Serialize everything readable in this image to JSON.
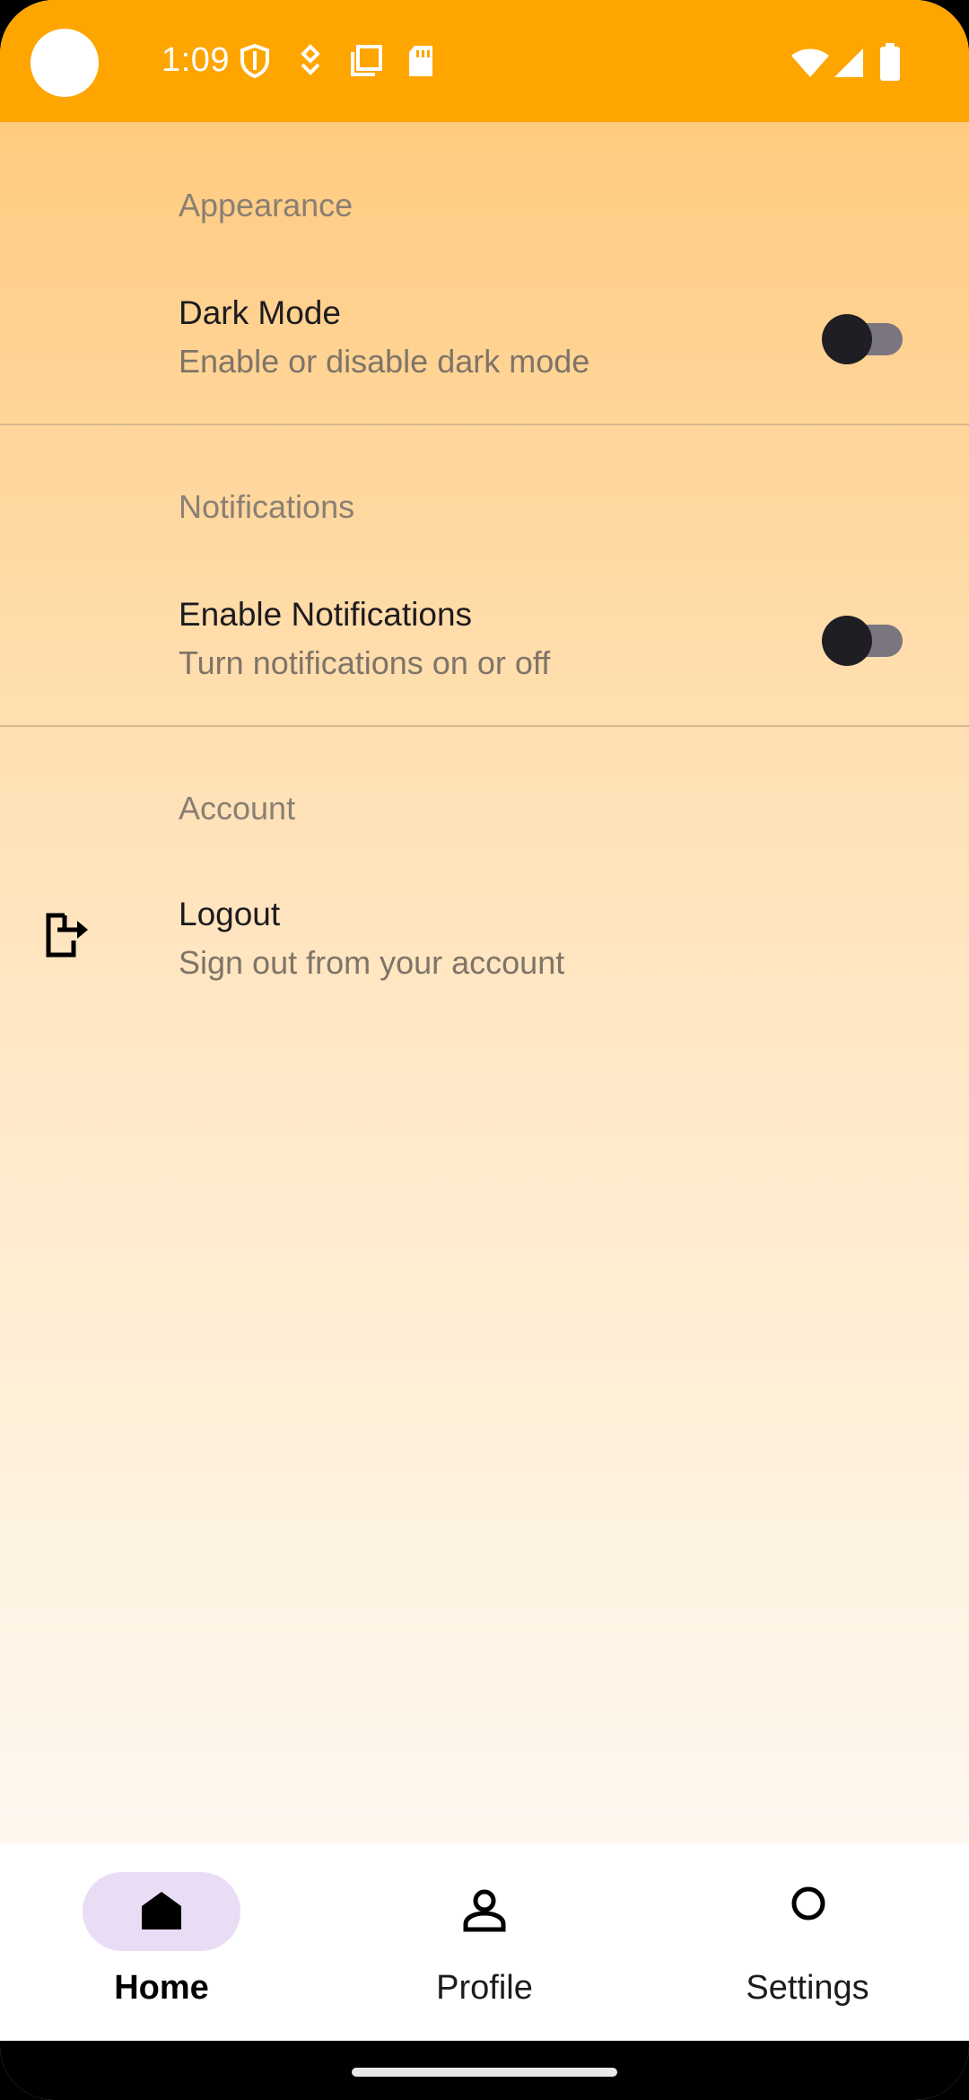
{
  "status_bar": {
    "time": "1:09",
    "left_icons": [
      "shield-icon",
      "download-icon",
      "copy-icon",
      "sd-card-icon"
    ],
    "right_icons": [
      "wifi-icon",
      "signal-icon",
      "battery-icon"
    ],
    "color": "#FFA500"
  },
  "settings": {
    "appearance": {
      "header": "Appearance",
      "dark_mode": {
        "title": "Dark Mode",
        "subtitle": "Enable or disable dark mode",
        "enabled": false
      }
    },
    "notifications": {
      "header": "Notifications",
      "enable": {
        "title": "Enable Notifications",
        "subtitle": "Turn notifications on or off",
        "enabled": false
      }
    },
    "account": {
      "header": "Account",
      "logout": {
        "title": "Logout",
        "subtitle": "Sign out from your account",
        "icon": "logout-icon"
      }
    }
  },
  "bottom_nav": {
    "items": [
      {
        "label": "Home",
        "icon": "home-icon",
        "active": true
      },
      {
        "label": "Profile",
        "icon": "person-icon",
        "active": false
      },
      {
        "label": "Settings",
        "icon": "circle-icon",
        "active": false
      }
    ]
  }
}
